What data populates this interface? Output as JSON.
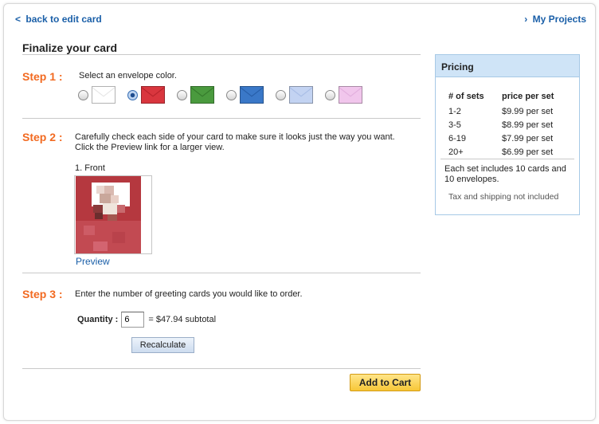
{
  "nav": {
    "back_label": "back to edit card",
    "back_chevron": "<",
    "projects_label": "My Projects",
    "projects_chevron": "›"
  },
  "page": {
    "title": "Finalize your card"
  },
  "step1": {
    "label": "Step 1 :",
    "text": "Select an envelope color.",
    "envelopes": [
      {
        "color_name": "white",
        "fill": "#ffffff",
        "flap": "#e6e6e6",
        "selected": false
      },
      {
        "color_name": "red",
        "fill": "#d9363e",
        "flap": "#b8232b",
        "selected": true
      },
      {
        "color_name": "green",
        "fill": "#4a9a3e",
        "flap": "#357a2b",
        "selected": false
      },
      {
        "color_name": "blue",
        "fill": "#3a78c8",
        "flap": "#275ea8",
        "selected": false
      },
      {
        "color_name": "light-blue",
        "fill": "#c3d3f2",
        "flap": "#a8bde6",
        "selected": false
      },
      {
        "color_name": "pink",
        "fill": "#f1c6ec",
        "flap": "#e2aede",
        "selected": false
      }
    ]
  },
  "step2": {
    "label": "Step 2 :",
    "text": "Carefully check each side of your card to make sure it looks just the way you want. Click the Preview link for a larger view.",
    "card_side_label": "1. Front",
    "preview_label": "Preview"
  },
  "step3": {
    "label": "Step 3 :",
    "text": "Enter the number of greeting cards you would like to order.",
    "quantity_label": "Quantity :",
    "quantity_value": "6",
    "subtotal_text": "= $47.94 subtotal",
    "recalculate_label": "Recalculate"
  },
  "cart": {
    "add_label": "Add to Cart"
  },
  "pricing": {
    "title": "Pricing",
    "headers": [
      "# of sets",
      "price per set"
    ],
    "rows": [
      [
        "1-2",
        "$9.99 per set"
      ],
      [
        "3-5",
        "$8.99 per set"
      ],
      [
        "6-19",
        "$7.99 per set"
      ],
      [
        "20+",
        "$6.99 per set"
      ]
    ],
    "note": "Each set includes 10 cards and 10 envelopes.",
    "tax_note": "Tax and shipping not included"
  },
  "colors": {
    "accent_orange": "#f26a21",
    "link_blue": "#1a5fa8",
    "pricing_header_bg": "#cfe4f7",
    "cart_button": "#f7c737"
  }
}
